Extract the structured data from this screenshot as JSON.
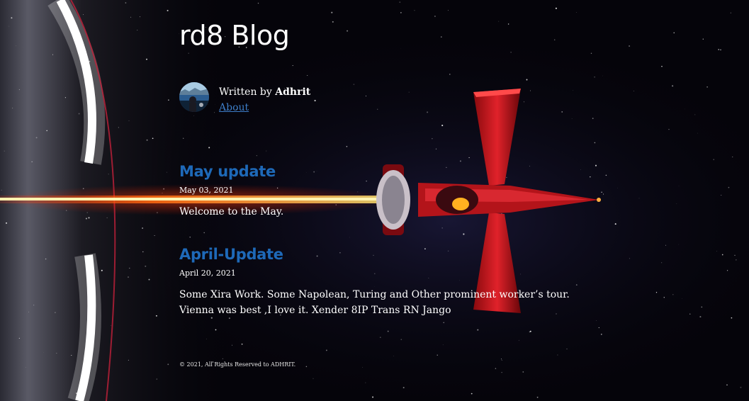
{
  "site": {
    "title": "rd8 Blog"
  },
  "bio": {
    "written_by": "Written by ",
    "author": "Adhrit",
    "about_label": "About"
  },
  "posts": [
    {
      "title": "May update",
      "date": "May 03, 2021",
      "excerpt": "Welcome to the May."
    },
    {
      "title": "April-Update",
      "date": "April 20, 2021",
      "excerpt": "Some Xira Work. Some Napolean, Turing and Other prominent worker’s tour. Vienna was best ,I love it. Xender 8IP Trans RN Jango"
    }
  ],
  "footer": {
    "text": "© 2021, All Rights Reserved to ADHRIT."
  },
  "colors": {
    "post_title": "#1e69b8",
    "link": "#3d7dc8",
    "background": "#05040a",
    "ship_red": "#d0161c",
    "laser": "#ff8a1a"
  },
  "icons": {
    "avatar": "profile-photo"
  }
}
